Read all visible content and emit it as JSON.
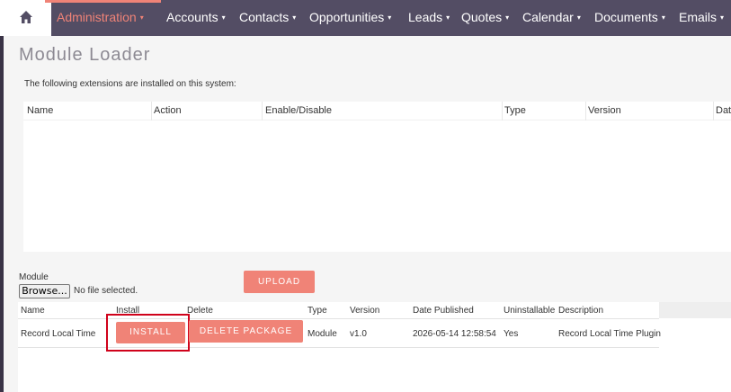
{
  "nav": {
    "home_icon": "home-icon",
    "items": [
      {
        "label": "Administration",
        "active": true
      },
      {
        "label": "Accounts"
      },
      {
        "label": "Contacts"
      },
      {
        "label": "Opportunities"
      },
      {
        "label": "Leads"
      },
      {
        "label": "Quotes"
      },
      {
        "label": "Calendar"
      },
      {
        "label": "Documents"
      },
      {
        "label": "Emails"
      }
    ],
    "caret": "▾"
  },
  "page": {
    "title": "Module Loader",
    "intro": "The following extensions are installed on this system:"
  },
  "extensions_table": {
    "columns": [
      "Name",
      "Action",
      "Enable/Disable",
      "Type",
      "Version",
      "Dat"
    ]
  },
  "upload_form": {
    "module_label": "Module",
    "browse_label": "Browse...",
    "no_file_text": "No file selected.",
    "upload_label": "UPLOAD"
  },
  "packages_table": {
    "columns": [
      "Name",
      "Install",
      "Delete",
      "Type",
      "Version",
      "Date Published",
      "Uninstallable",
      "Description"
    ],
    "rows": [
      {
        "name": "Record Local Time",
        "install_label": "INSTALL",
        "delete_label": "DELETE PACKAGE",
        "type": "Module",
        "version": "v1.0",
        "date_published": "2026-05-14 12:58:54",
        "uninstallable": "Yes",
        "description": "Record Local Time Plugin"
      }
    ]
  },
  "colors": {
    "nav_bg": "#534d64",
    "accent": "#f08377",
    "highlight": "#d0021b"
  }
}
